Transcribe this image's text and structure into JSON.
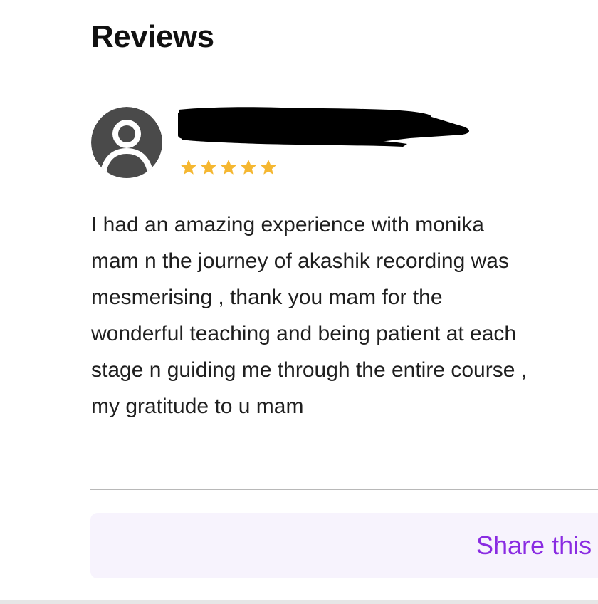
{
  "reviews_section": {
    "title": "Reviews"
  },
  "review": {
    "reviewer_name": "",
    "rating": 5,
    "rating_max": 5,
    "star_color": "#f5b731",
    "text": "I had an amazing experience with monika\nmam n the journey of akashik recording was\nmesmerising  , thank you mam for the\nwonderful teaching and being patient at each\nstage n guiding me through the entire course ,\nmy gratitude to u mam",
    "avatar_icon": "user-avatar-icon"
  },
  "share": {
    "label": "Share this",
    "color": "#8a2be2",
    "background": "#f7f3fd"
  }
}
